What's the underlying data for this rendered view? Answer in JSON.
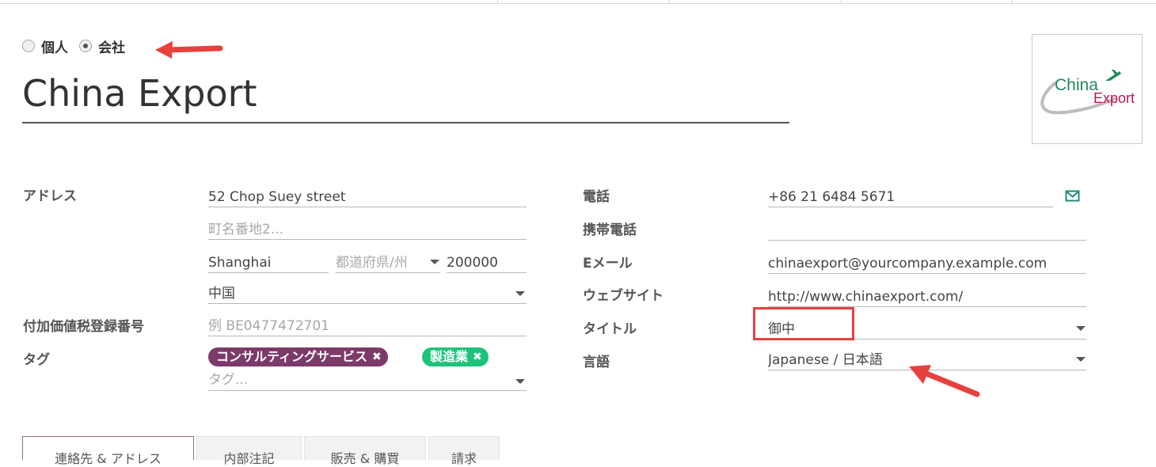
{
  "company_type": {
    "individual_label": "個人",
    "company_label": "会社",
    "selected": "company"
  },
  "partner_name": "China Export",
  "logo": {
    "line1": "China",
    "line2": "Export",
    "icon": "airplane-icon"
  },
  "address": {
    "label": "アドレス",
    "street": "52 Chop Suey street",
    "street2_placeholder": "町名番地2...",
    "city": "Shanghai",
    "state_placeholder": "都道府県/州",
    "zip": "200000",
    "country": "中国"
  },
  "vat": {
    "label": "付加価値税登録番号",
    "placeholder": "例 BE0477472701"
  },
  "tags": {
    "label": "タグ",
    "items": [
      {
        "label": "コンサルティングサービス",
        "color": "#7c3a6b"
      },
      {
        "label": "製造業",
        "color": "#1fc27c"
      }
    ],
    "placeholder": "タグ..."
  },
  "phone": {
    "label": "電話",
    "value": "+86 21 6484 5671",
    "icon": "envelope-icon"
  },
  "mobile": {
    "label": "携帯電話",
    "value": ""
  },
  "email": {
    "label": "Eメール",
    "value": "chinaexport@yourcompany.example.com"
  },
  "website": {
    "label": "ウェブサイト",
    "value": "http://www.chinaexport.com/"
  },
  "title": {
    "label": "タイトル",
    "value": "御中"
  },
  "language": {
    "label": "言語",
    "value": "Japanese / 日本語"
  },
  "tabs": [
    {
      "label": "連絡先 & アドレス"
    },
    {
      "label": "内部注記"
    },
    {
      "label": "販売 & 購買"
    },
    {
      "label": "請求"
    }
  ],
  "colors": {
    "accent": "#7c3a6b",
    "annotation": "#e8403c",
    "tag_green": "#1fc27c",
    "logo_green": "#1f8a5c",
    "logo_red": "#c4124b"
  }
}
